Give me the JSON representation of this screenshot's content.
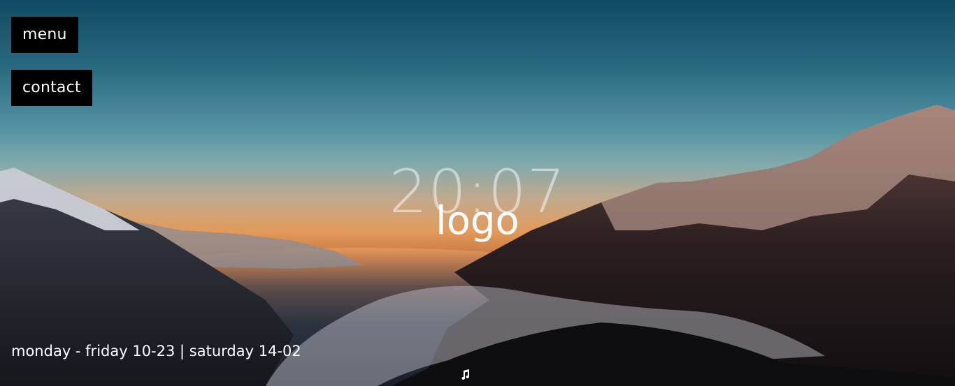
{
  "nav": {
    "menu_label": "menu",
    "contact_label": "contact"
  },
  "hero": {
    "clock": "20:07",
    "logo": "logo"
  },
  "footer": {
    "opening_hours": "monday - friday 10-23 | saturday 14-02"
  },
  "icons": {
    "music": "music-note-icon"
  },
  "colors": {
    "button_bg": "#000000",
    "text": "#ffffff"
  }
}
